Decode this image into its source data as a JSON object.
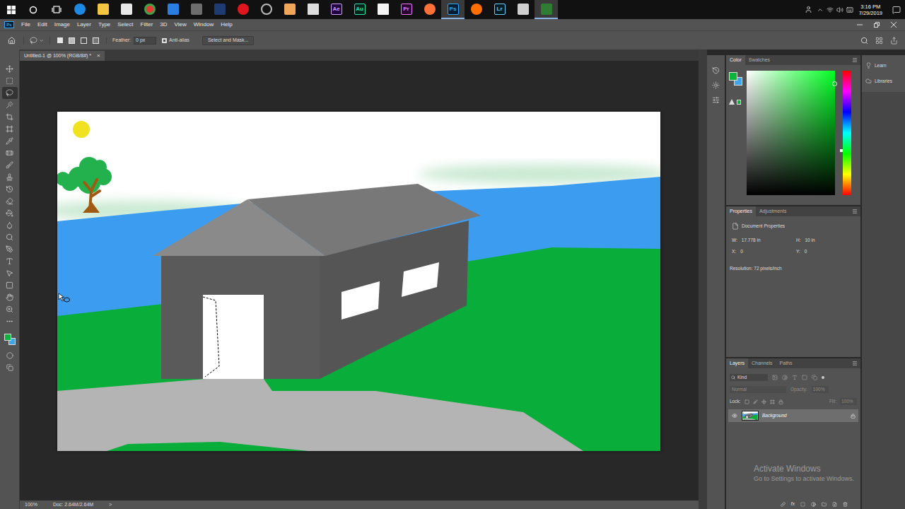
{
  "taskbar": {
    "apps": [
      {
        "active": false
      },
      {
        "active": false
      },
      {
        "active": false
      },
      {
        "active": false
      },
      {
        "active": false
      },
      {
        "active": false
      },
      {
        "active": false
      },
      {
        "active": false
      },
      {
        "active": false
      },
      {
        "active": false
      },
      {
        "active": false
      },
      {
        "label": "Ae",
        "active": false
      },
      {
        "label": "Au",
        "active": false
      },
      {
        "active": false
      },
      {
        "label": "Pr",
        "active": false
      },
      {
        "active": false
      },
      {
        "label": "Ps",
        "active": true
      },
      {
        "active": false
      },
      {
        "label": "Lr",
        "active": false
      },
      {
        "active": false
      },
      {
        "active": true
      }
    ],
    "tray": {
      "time": "3:16 PM",
      "date": "7/29/2019"
    }
  },
  "menu": {
    "logo": "Ps",
    "items": [
      "File",
      "Edit",
      "Image",
      "Layer",
      "Type",
      "Select",
      "Filter",
      "3D",
      "View",
      "Window",
      "Help"
    ]
  },
  "options": {
    "feather_label": "Feather:",
    "feather_value": "0 px",
    "anti_alias": {
      "label": "Anti-alias",
      "checked": true
    },
    "select_mask": "Select and Mask..."
  },
  "document": {
    "tab": "Untitled-1 @ 100% (RGB/8#) *",
    "close": "×"
  },
  "tools": [
    {
      "selected": false
    },
    {
      "selected": false
    },
    {
      "selected": true
    },
    {
      "selected": false
    },
    {
      "selected": false
    },
    {
      "selected": false
    },
    {
      "selected": false
    },
    {
      "selected": false
    },
    {
      "selected": false
    },
    {
      "selected": false
    },
    {
      "selected": false
    },
    {
      "selected": false
    },
    {
      "selected": false
    },
    {
      "selected": false
    },
    {
      "selected": false
    },
    {
      "selected": false
    },
    {
      "selected": false
    },
    {
      "selected": false
    },
    {
      "selected": false
    },
    {
      "selected": false
    },
    {
      "selected": false
    }
  ],
  "color_panel": {
    "tabs": [
      {
        "label": "Color",
        "selected": true
      },
      {
        "label": "Swatches",
        "selected": false
      }
    ],
    "foreground": "#0db43c",
    "background": "#41a4e8",
    "hue_level": 0.64,
    "picker": {
      "x": 0.99,
      "y": 0.1
    }
  },
  "properties": {
    "tabs": [
      {
        "label": "Properties",
        "selected": true
      },
      {
        "label": "Adjustments",
        "selected": false
      }
    ],
    "title": "Document Properties",
    "fields": [
      {
        "label": "W:",
        "value": "17.778 in"
      },
      {
        "label": "H:",
        "value": "10 in"
      },
      {
        "label": "X:",
        "value": "0"
      },
      {
        "label": "Y:",
        "value": "0"
      }
    ],
    "resolution": "Resolution: 72 pixels/inch"
  },
  "layers": {
    "tabs": [
      {
        "label": "Layers",
        "selected": true
      },
      {
        "label": "Channels",
        "selected": false
      },
      {
        "label": "Paths",
        "selected": false
      }
    ],
    "filter": "Kind",
    "blend_mode": "Normal",
    "opacity_label": "Opacity:",
    "opacity": "100%",
    "lock_label": "Lock:",
    "fill_label": "Fill:",
    "fill": "100%",
    "controls_disabled": true,
    "footer_fx": "fx",
    "items": [
      {
        "name": "Background",
        "visible": true,
        "locked": true,
        "selected": true
      }
    ]
  },
  "side_panel": {
    "items": [
      "Learn",
      "Libraries"
    ]
  },
  "status_bar": {
    "zoom": "100%",
    "doc": "Doc: 2.64M/2.64M",
    "arrow": ">"
  },
  "watermark": {
    "title": "Activate Windows",
    "subtitle": "Go to Settings to activate Windows."
  }
}
